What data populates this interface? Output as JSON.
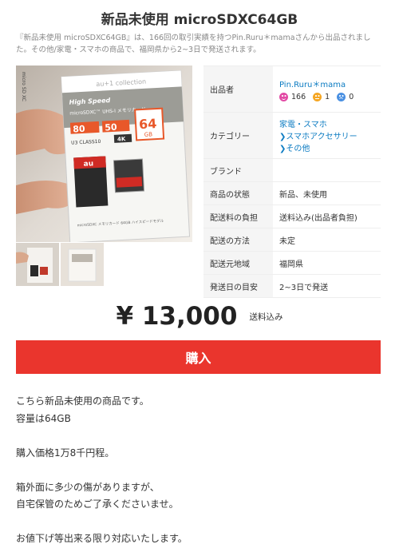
{
  "item": {
    "title": "新品未使用 microSDXC64GB",
    "summary": "『新品未使用 microSDXC64GB』は、166回の取引実績を持つPin.Ruru＊mamaさんから出品されました。その他/家電・スマホの商品で、福岡県から2~3日で発送されます。"
  },
  "photo": {
    "card_brand": "au+1 collection",
    "card_speed": "High Speed",
    "card_type": "microSDXC™ UHS-I メモリカード",
    "capacity": "64",
    "capacity_unit": "GB",
    "speed_read": "80",
    "speed_write": "50",
    "sd_label": "micro SD XC",
    "class_label": "U3 CLASS10",
    "badge_4k": "4K",
    "au_logo": "au",
    "bottom_text": "microSDXC メモリカード 64GB ハイスピードモデル"
  },
  "details": {
    "seller_label": "出品者",
    "seller_name": "Pin.Ruru＊mama",
    "rating_good": "166",
    "rating_normal": "1",
    "rating_bad": "0",
    "category_label": "カテゴリー",
    "category_1": "家電・スマホ",
    "category_2": "スマホアクセサリー",
    "category_3": "その他",
    "brand_label": "ブランド",
    "brand_value": "",
    "condition_label": "商品の状態",
    "condition_value": "新品、未使用",
    "shipping_fee_label": "配送料の負担",
    "shipping_fee_value": "送料込み(出品者負担)",
    "shipping_method_label": "配送の方法",
    "shipping_method_value": "未定",
    "ship_from_label": "配送元地域",
    "ship_from_value": "福岡県",
    "ship_days_label": "発送日の目安",
    "ship_days_value": "2~3日で発送"
  },
  "price": {
    "amount": "¥ 13,000",
    "note": "送料込み"
  },
  "buy_button": "購入",
  "description": {
    "line1": "こちら新品未使用の商品です。",
    "line2": "容量は64GB",
    "line3": "購入価格1万8千円程。",
    "line4": "箱外面に多少の傷がありますが、",
    "line5": "自宅保管のためご了承くださいませ。",
    "line6": "お値下げ等出来る限り対応いたします。"
  },
  "colors": {
    "accent": "#ea352d",
    "link": "#0b7bc2",
    "rating_good": "#e24aa5",
    "rating_normal": "#f5a623",
    "rating_bad": "#4a90e2"
  }
}
